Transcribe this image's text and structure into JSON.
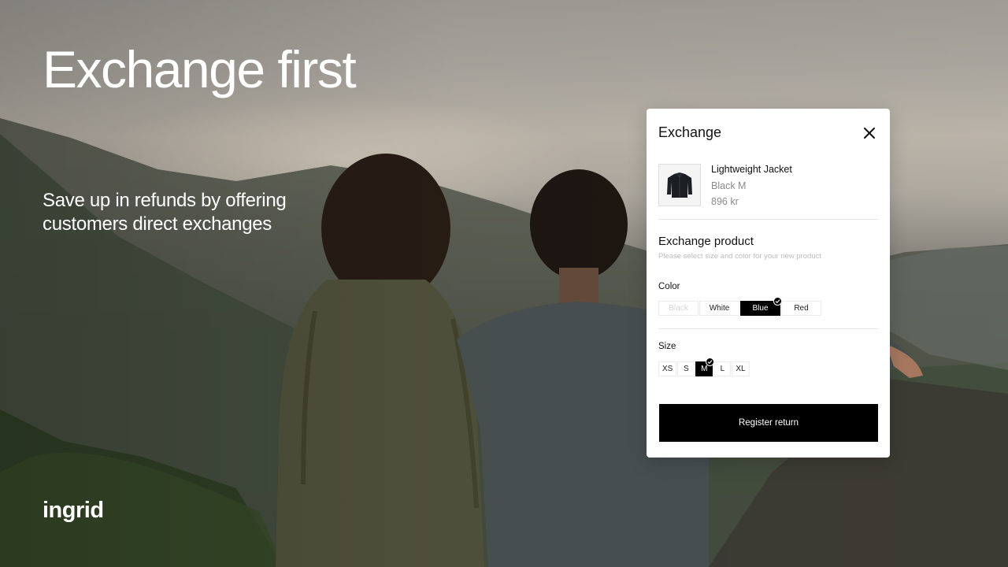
{
  "hero": {
    "title": "Exchange first",
    "subtitle": "Save up in refunds by offering customers direct exchanges"
  },
  "brand": {
    "logo_text": "ingrid"
  },
  "modal": {
    "title": "Exchange",
    "close_icon": "close-icon",
    "product": {
      "name": "Lightweight Jacket",
      "variant": "Black M",
      "price": "896 kr",
      "image_icon": "jacket-icon"
    },
    "section": {
      "title": "Exchange product",
      "hint": "Please select size and color for your new product"
    },
    "color": {
      "label": "Color",
      "options": [
        "Black",
        "White",
        "Blue",
        "Red"
      ],
      "selected": "Blue",
      "disabled": [
        "Black"
      ]
    },
    "size": {
      "label": "Size",
      "options": [
        "XS",
        "S",
        "M",
        "L",
        "XL"
      ],
      "selected": "M"
    },
    "submit_label": "Register return"
  },
  "colors": {
    "accent": "#000000",
    "modal_bg": "#ffffff",
    "muted_text": "#8a8a8a",
    "hint_text": "#bdbdbd"
  }
}
